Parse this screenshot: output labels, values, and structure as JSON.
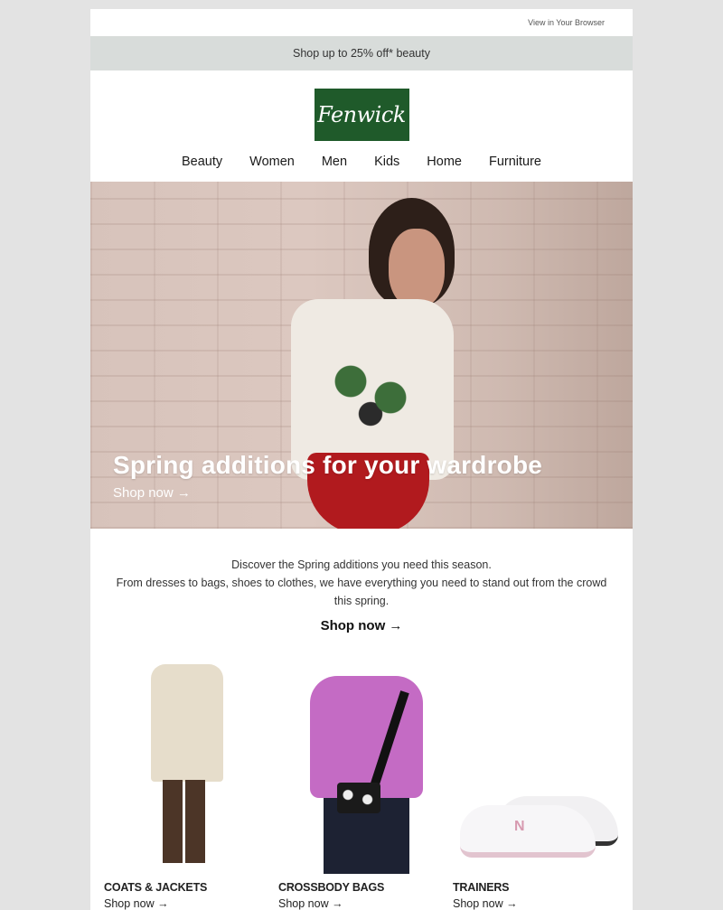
{
  "topbar": {
    "view_in_browser": "View in Your Browser"
  },
  "promo": {
    "text": "Shop up to 25% off* beauty"
  },
  "brand": {
    "logo_text": "Fenwick",
    "logo_color": "#1f5a2a"
  },
  "nav": {
    "items": [
      {
        "label": "Beauty"
      },
      {
        "label": "Women"
      },
      {
        "label": "Men"
      },
      {
        "label": "Kids"
      },
      {
        "label": "Home"
      },
      {
        "label": "Furniture"
      }
    ]
  },
  "hero": {
    "title": "Spring additions for your wardrobe",
    "cta": "Shop now →",
    "image_alt": "Woman in white tropical print t-shirt and red briefs against pink brick wall"
  },
  "intro": {
    "line1": "Discover the Spring additions you need this season.",
    "line2": "From dresses to bags, shoes to clothes, we have everything you need to stand out from the crowd this spring.",
    "cta": "Shop now →"
  },
  "products": [
    {
      "label": "COATS & JACKETS",
      "cta": "Shop now →",
      "image_alt": "Cream coat with brown trousers"
    },
    {
      "label": "CROSSBODY BAGS",
      "cta": "Shop now →",
      "image_alt": "Pink cardigan with floral crossbody bag"
    },
    {
      "label": "TRAINERS",
      "cta": "Shop now →",
      "image_alt": "White and pink trainers"
    }
  ]
}
